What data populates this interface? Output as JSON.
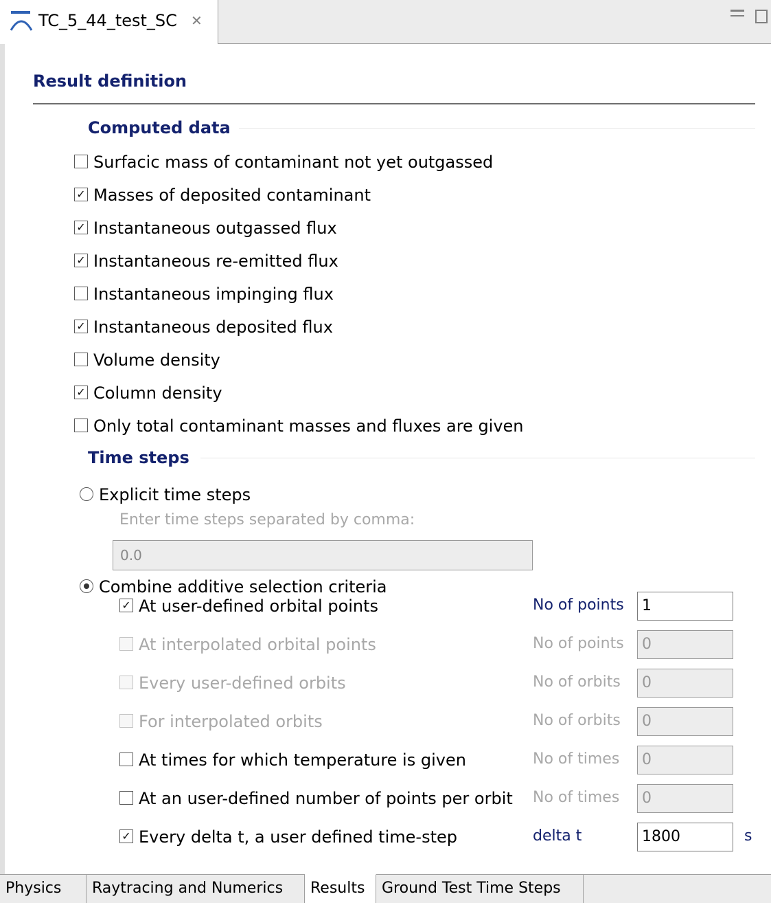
{
  "editor": {
    "tab_title": "TC_5_44_test_SC",
    "tab_icon": "model-icon",
    "close_glyph": "✕"
  },
  "page": {
    "section_title": "Result definition"
  },
  "computed_data": {
    "title": "Computed data",
    "items": [
      {
        "label": "Surfacic mass of contaminant not yet outgassed",
        "checked": false
      },
      {
        "label": "Masses of deposited contaminant",
        "checked": true
      },
      {
        "label": "Instantaneous outgassed flux",
        "checked": true
      },
      {
        "label": "Instantaneous re-emitted flux",
        "checked": true
      },
      {
        "label": "Instantaneous impinging flux",
        "checked": false
      },
      {
        "label": "Instantaneous deposited flux",
        "checked": true
      },
      {
        "label": "Volume density",
        "checked": false
      },
      {
        "label": "Column density",
        "checked": true
      },
      {
        "label": "Only total contaminant masses and fluxes are given",
        "checked": false
      }
    ]
  },
  "time_steps": {
    "title": "Time steps",
    "explicit": {
      "label": "Explicit time steps",
      "selected": false
    },
    "hint": "Enter time steps separated by comma:",
    "explicit_value": "0.0",
    "combine": {
      "label": "Combine additive selection criteria",
      "selected": true
    },
    "criteria": [
      {
        "label": "At user-defined orbital points",
        "checked": true,
        "enabled": true,
        "field_label": "No of points",
        "value": "1",
        "field_enabled": true,
        "unit": ""
      },
      {
        "label": "At interpolated orbital points",
        "checked": false,
        "enabled": false,
        "field_label": "No of points",
        "value": "0",
        "field_enabled": false,
        "unit": ""
      },
      {
        "label": "Every user-defined orbits",
        "checked": false,
        "enabled": false,
        "field_label": "No of orbits",
        "value": "0",
        "field_enabled": false,
        "unit": ""
      },
      {
        "label": "For interpolated orbits",
        "checked": false,
        "enabled": false,
        "field_label": "No of orbits",
        "value": "0",
        "field_enabled": false,
        "unit": ""
      },
      {
        "label": "At times for which temperature is given",
        "checked": false,
        "enabled": true,
        "field_label": "No of times",
        "value": "0",
        "field_enabled": false,
        "unit": ""
      },
      {
        "label": "At an user-defined number of points per orbit",
        "checked": false,
        "enabled": true,
        "field_label": "No of times",
        "value": "0",
        "field_enabled": false,
        "unit": ""
      },
      {
        "label": "Every delta t, a user defined time-step",
        "checked": true,
        "enabled": true,
        "field_label": "delta t",
        "value": "1800",
        "field_enabled": true,
        "unit": "s"
      }
    ]
  },
  "bottom_tabs": [
    {
      "label": "Physics",
      "active": false
    },
    {
      "label": "Raytracing and Numerics",
      "active": false
    },
    {
      "label": "Results",
      "active": true
    },
    {
      "label": "Ground Test Time Steps",
      "active": false
    }
  ]
}
